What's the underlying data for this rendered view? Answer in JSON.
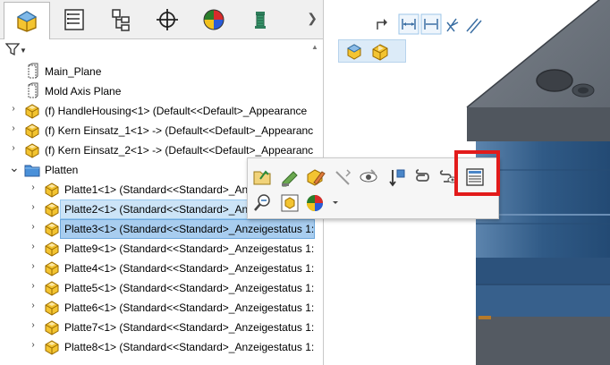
{
  "feature_tree": {
    "filter_label": "Filter",
    "items": [
      {
        "label": "Main_Plane",
        "kind": "plane"
      },
      {
        "label": "Mold Axis Plane",
        "kind": "plane"
      },
      {
        "label": "(f) HandleHousing<1> (Default<<Default>_Appearance",
        "kind": "part"
      },
      {
        "label": "(f) Kern Einsatz_1<1> -> (Default<<Default>_Appearanc",
        "kind": "part"
      },
      {
        "label": "(f) Kern Einsatz_2<1> -> (Default<<Default>_Appearanc",
        "kind": "part"
      },
      {
        "label": "Platten",
        "kind": "folder"
      },
      {
        "label": "Platte1<1> (Standard<<Standard>_Anzeigestatus 1:",
        "kind": "part"
      },
      {
        "label": "Platte2<1> (Standard<<Standard>_Anzeigestatus 1:",
        "kind": "part"
      },
      {
        "label": "Platte3<1> (Standard<<Standard>_Anzeigestatus 1:",
        "kind": "part"
      },
      {
        "label": "Platte9<1> (Standard<<Standard>_Anzeigestatus 1:",
        "kind": "part"
      },
      {
        "label": "Platte4<1> (Standard<<Standard>_Anzeigestatus 1:",
        "kind": "part"
      },
      {
        "label": "Platte5<1> (Standard<<Standard>_Anzeigestatus 1:",
        "kind": "part"
      },
      {
        "label": "Platte6<1> (Standard<<Standard>_Anzeigestatus 1:",
        "kind": "part"
      },
      {
        "label": "Platte7<1> (Standard<<Standard>_Anzeigestatus 1:",
        "kind": "part"
      },
      {
        "label": "Platte8<1> (Standard<<Standard>_Anzeigestatus 1:",
        "kind": "part"
      }
    ],
    "selected": [
      "Platte2<1>",
      "Platte3<1>"
    ]
  },
  "tabs": [
    {
      "icon": "feature-manager-icon",
      "active": true
    },
    {
      "icon": "property-manager-icon",
      "active": false
    },
    {
      "icon": "configuration-manager-icon",
      "active": false
    },
    {
      "icon": "dimxpert-manager-icon",
      "active": false
    },
    {
      "icon": "display-manager-icon",
      "active": false
    },
    {
      "icon": "cam-manager-icon",
      "active": false
    }
  ],
  "heads_up_toolbar": [
    "sketch-arrow-icon",
    "dimension-horizontal-icon",
    "dimension-vertical-icon",
    "angle-icon",
    "parallel-icon"
  ],
  "context_toolbar": {
    "row1": [
      "open-part-icon",
      "edit-part-icon",
      "appearance-pencil-icon",
      "hide-icon",
      "show-icon",
      "move-icon",
      "mates-icon",
      "view-mates-icon",
      "configurations-icon"
    ],
    "row2": [
      "zoom-to-selection-icon",
      "isolate-icon",
      "appearance-icon"
    ],
    "highlighted": "configurations-icon"
  },
  "colors": {
    "highlight": "#e21b1b",
    "selection": "#cce4f7",
    "part_yellow": "#f3c431",
    "model_blue": "#2e5580",
    "model_gray": "#555b63"
  }
}
